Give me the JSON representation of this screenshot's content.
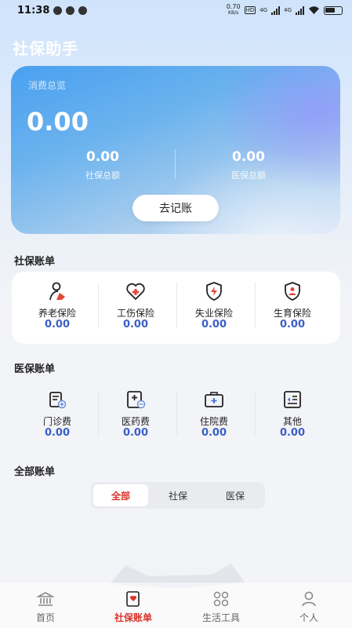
{
  "status_bar": {
    "time": "11:38",
    "net_speed": "0.70",
    "net_unit": "KB/s",
    "hd": "HD",
    "signal1": "4G",
    "signal2": "4G"
  },
  "app_title": "社保助手",
  "summary": {
    "label": "消费总览",
    "total": "0.00",
    "social_value": "0.00",
    "social_label": "社保总额",
    "medical_value": "0.00",
    "medical_label": "医保总额",
    "button_label": "去记账"
  },
  "social_section": {
    "title": "社保账单",
    "items": [
      {
        "label": "养老保险",
        "value": "0.00",
        "icon": "pension-icon"
      },
      {
        "label": "工伤保险",
        "value": "0.00",
        "icon": "injury-heart-icon"
      },
      {
        "label": "失业保险",
        "value": "0.00",
        "icon": "unemployment-shield-icon"
      },
      {
        "label": "生育保险",
        "value": "0.00",
        "icon": "maternity-shield-icon"
      }
    ]
  },
  "medical_section": {
    "title": "医保账单",
    "items": [
      {
        "label": "门诊费",
        "value": "0.00",
        "icon": "outpatient-icon"
      },
      {
        "label": "医药费",
        "value": "0.00",
        "icon": "medicine-icon"
      },
      {
        "label": "住院费",
        "value": "0.00",
        "icon": "hospital-kit-icon"
      },
      {
        "label": "其他",
        "value": "0.00",
        "icon": "other-card-icon"
      }
    ]
  },
  "all_section": {
    "title": "全部账单",
    "tabs": [
      "全部",
      "社保",
      "医保"
    ],
    "active_tab": "全部"
  },
  "bottom_nav": {
    "items": [
      {
        "label": "首页",
        "icon": "home-bank-icon"
      },
      {
        "label": "社保账单",
        "icon": "bill-icon"
      },
      {
        "label": "生活工具",
        "icon": "tools-grid-icon"
      },
      {
        "label": "个人",
        "icon": "user-icon"
      }
    ],
    "active": "社保账单"
  },
  "colors": {
    "accent_red": "#d9342a",
    "value_blue": "#3b5fc7",
    "card_blue": "#4aa0f0"
  }
}
